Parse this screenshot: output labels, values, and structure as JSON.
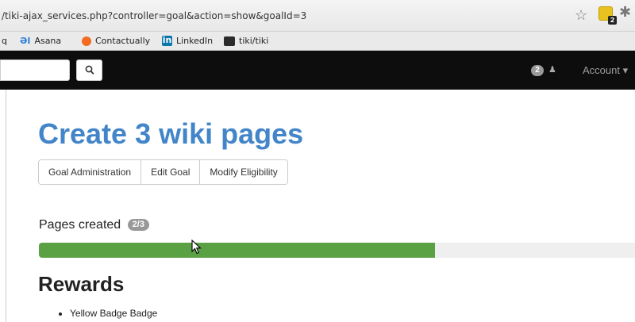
{
  "browser": {
    "url": "/tiki-ajax_services.php?controller=goal&action=show&goalId=3",
    "extension_badge": "2",
    "bookmarks": [
      {
        "label": "q",
        "icon": "none"
      },
      {
        "label": "Asana",
        "icon": "asana-icon"
      },
      {
        "label": "Contactually",
        "icon": "contactually-icon"
      },
      {
        "label": "LinkedIn",
        "icon": "linkedin-icon"
      },
      {
        "label": "tiki/tiki",
        "icon": "tiki-icon"
      }
    ]
  },
  "navbar": {
    "search_icon": "magnifier-icon",
    "notification_count": "2",
    "account_label": "Account ▾"
  },
  "goal": {
    "title": "Create 3 wiki pages",
    "actions": [
      "Goal Administration",
      "Edit Goal",
      "Modify Eligibility"
    ],
    "progress_label": "Pages created",
    "progress_count": "2/3",
    "progress_fraction": 0.665,
    "progress_color": "#5aa143"
  },
  "rewards": {
    "title": "Rewards",
    "items": [
      "Yellow Badge Badge"
    ]
  },
  "colors": {
    "title": "#4285c8",
    "navbar_bg": "#0d0d0d"
  }
}
